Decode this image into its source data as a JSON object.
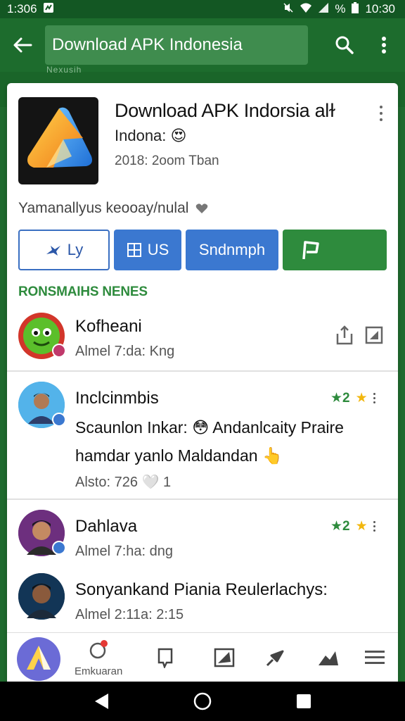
{
  "status_bar": {
    "time": "1:306",
    "clock": "10:30",
    "battery_text": "%"
  },
  "app_bar": {
    "search_value": "Download APK Indonesia"
  },
  "behind_hint": "Nexusih",
  "app": {
    "title": "Download APK Indorsia alɫ",
    "subtitle": "Indona: 😍",
    "meta": "2018: 2oom Tban",
    "summary": "Yamanallyus keooay/nulal"
  },
  "actions": {
    "outline_label": "Ly",
    "blue1_label": "US",
    "blue2_label": "Sndnmph",
    "colors": {
      "blue": "#3b78d0",
      "green": "#2e8b3d"
    }
  },
  "section_label": "RONSMAIHS NENES",
  "rows": [
    {
      "name": "Kofheani",
      "meta": "Almel 7:da: Kng"
    },
    {
      "name": "Inclcinmbis",
      "rating": "★2",
      "line1": "Scaunlon Inkar: 😳 Andanlcaity Praire",
      "line2": "hamdar yanlo Maldandan 👆",
      "meta": "Alsto: 726 🤍 1"
    },
    {
      "name": "Dahlava",
      "rating": "★2",
      "meta": "Almel 7:ha: dng"
    },
    {
      "name": "Sonyankand Piania Reulerlachys:",
      "meta": "Almel 2:11a: 2:15"
    }
  ],
  "bottom_nav": {
    "label": "Emkuaran"
  }
}
